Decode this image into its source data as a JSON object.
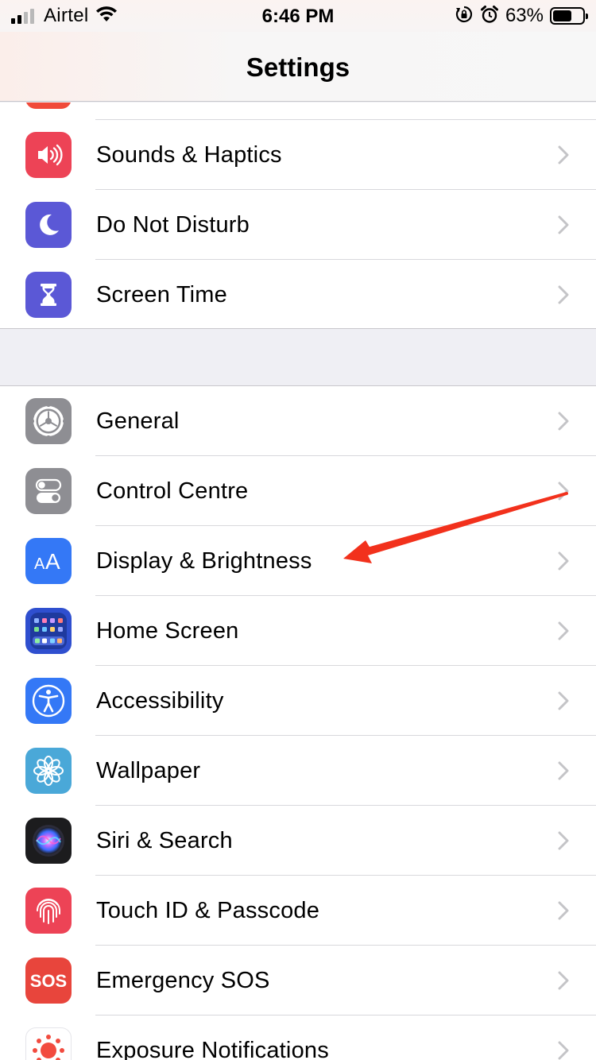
{
  "status_bar": {
    "carrier": "Airtel",
    "time": "6:46 PM",
    "battery_percent": "63%",
    "battery_level": 0.63,
    "icons": [
      "signal-bars-icon",
      "wifi-icon",
      "orientation-lock-icon",
      "alarm-icon",
      "battery-icon"
    ]
  },
  "nav": {
    "title": "Settings"
  },
  "groups": [
    {
      "items": [
        {
          "label": "Sounds & Haptics",
          "icon": "speaker-icon",
          "color": "#ed4356"
        },
        {
          "label": "Do Not Disturb",
          "icon": "moon-icon",
          "color": "#5b58d6"
        },
        {
          "label": "Screen Time",
          "icon": "hourglass-icon",
          "color": "#5b58d6"
        }
      ]
    },
    {
      "items": [
        {
          "label": "General",
          "icon": "gear-icon",
          "color": "#8e8e93"
        },
        {
          "label": "Control Centre",
          "icon": "toggles-icon",
          "color": "#8e8e93"
        },
        {
          "label": "Display & Brightness",
          "icon": "text-size-icon",
          "color": "#3478f6"
        },
        {
          "label": "Home Screen",
          "icon": "app-grid-icon",
          "color": "#2f4fcf"
        },
        {
          "label": "Accessibility",
          "icon": "accessibility-icon",
          "color": "#3478f6"
        },
        {
          "label": "Wallpaper",
          "icon": "flower-icon",
          "color": "#4aa8d8"
        },
        {
          "label": "Siri & Search",
          "icon": "siri-icon",
          "color": "#1c1c1e"
        },
        {
          "label": "Touch ID & Passcode",
          "icon": "fingerprint-icon",
          "color": "#ed4356"
        },
        {
          "label": "Emergency SOS",
          "icon": "sos-icon",
          "color": "#e8453c"
        },
        {
          "label": "Exposure Notifications",
          "icon": "exposure-icon",
          "color": "#ffffff"
        }
      ]
    }
  ],
  "annotation": {
    "type": "arrow",
    "color": "#f2311c",
    "points_to": "Display & Brightness"
  }
}
